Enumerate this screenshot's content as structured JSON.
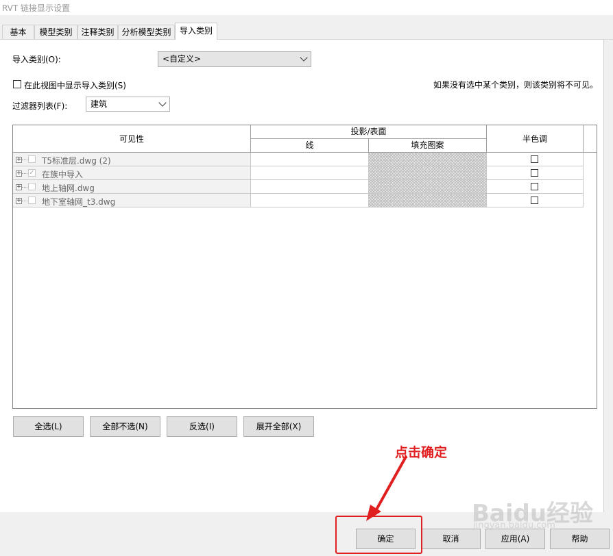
{
  "window": {
    "title": "RVT 链接显示设置"
  },
  "tabs": [
    {
      "label": "基本",
      "active": false
    },
    {
      "label": "模型类别",
      "active": false
    },
    {
      "label": "注释类别",
      "active": false
    },
    {
      "label": "分析模型类别",
      "active": false
    },
    {
      "label": "导入类别",
      "active": true
    }
  ],
  "form": {
    "import_category_label": "导入类别(O):",
    "import_category_value": "<自定义>",
    "show_in_view_label": "在此视图中显示导入类别(S)",
    "show_in_view_checked": false,
    "hint": "如果没有选中某个类别，则该类别将不可见。",
    "filter_label": "过滤器列表(F):",
    "filter_value": "建筑"
  },
  "table": {
    "col_visibility": "可见性",
    "col_projection_group": "投影/表面",
    "col_line": "线",
    "col_fill": "填充图案",
    "col_halftone": "半色调",
    "rows": [
      {
        "name": "T5标准层.dwg (2)",
        "visible": false,
        "halftone": false
      },
      {
        "name": "在族中导入",
        "visible": true,
        "halftone": false
      },
      {
        "name": "地上轴网.dwg",
        "visible": false,
        "halftone": false
      },
      {
        "name": "地下室轴网_t3.dwg",
        "visible": false,
        "halftone": false
      }
    ]
  },
  "selection_buttons": {
    "select_all": "全选(L)",
    "select_none": "全部不选(N)",
    "invert": "反选(I)",
    "expand_all": "展开全部(X)"
  },
  "footer_buttons": {
    "ok": "确定",
    "cancel": "取消",
    "apply": "应用(A)",
    "help": "帮助"
  },
  "annotation": {
    "text": "点击确定",
    "color": "#e02020"
  },
  "watermark": {
    "brand": "Baidu经验",
    "url": "jingyan.baidu.com"
  }
}
